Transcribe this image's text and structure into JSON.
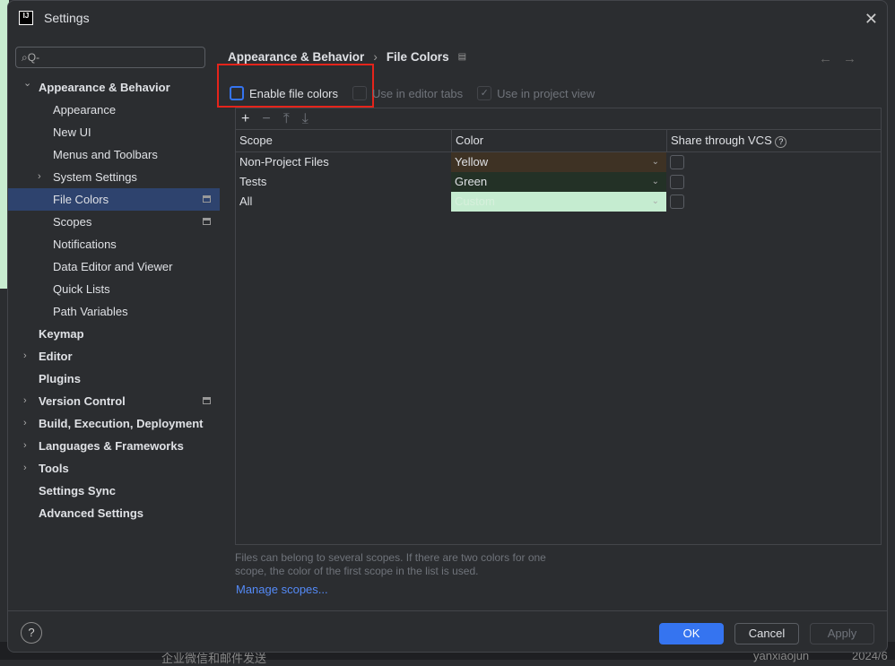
{
  "window": {
    "title": "Settings",
    "logo": "IJ"
  },
  "search": {
    "placeholder": "Q-"
  },
  "sidebar": {
    "items": [
      {
        "label": "Appearance & Behavior",
        "level": 0,
        "expanded": true
      },
      {
        "label": "Appearance",
        "level": 1
      },
      {
        "label": "New UI",
        "level": 1
      },
      {
        "label": "Menus and Toolbars",
        "level": 1
      },
      {
        "label": "System Settings",
        "level": 1,
        "collapsed": true
      },
      {
        "label": "File Colors",
        "level": 1,
        "selected": true,
        "mark": true
      },
      {
        "label": "Scopes",
        "level": 1,
        "mark": true
      },
      {
        "label": "Notifications",
        "level": 1
      },
      {
        "label": "Data Editor and Viewer",
        "level": 1
      },
      {
        "label": "Quick Lists",
        "level": 1
      },
      {
        "label": "Path Variables",
        "level": 1
      },
      {
        "label": "Keymap",
        "level": 0
      },
      {
        "label": "Editor",
        "level": 0,
        "collapsed": true
      },
      {
        "label": "Plugins",
        "level": 0
      },
      {
        "label": "Version Control",
        "level": 0,
        "collapsed": true,
        "mark": true
      },
      {
        "label": "Build, Execution, Deployment",
        "level": 0,
        "collapsed": true
      },
      {
        "label": "Languages & Frameworks",
        "level": 0,
        "collapsed": true
      },
      {
        "label": "Tools",
        "level": 0,
        "collapsed": true
      },
      {
        "label": "Settings Sync",
        "level": 0
      },
      {
        "label": "Advanced Settings",
        "level": 0
      }
    ]
  },
  "breadcrumb": {
    "parent": "Appearance & Behavior",
    "current": "File Colors"
  },
  "options": {
    "enable": "Enable file colors",
    "editor_tabs": "Use in editor tabs",
    "project_view": "Use in project view"
  },
  "table": {
    "headers": [
      "Scope",
      "Color",
      "Share through VCS"
    ],
    "rows": [
      {
        "scope": "Non-Project Files",
        "color": "Yellow",
        "bg": "#3e3224",
        "fg": "#dfe1e5"
      },
      {
        "scope": "Tests",
        "color": "Green",
        "bg": "#233126",
        "fg": "#dfe1e5"
      },
      {
        "scope": "All",
        "color": "Custom",
        "bg": "#c5ecd0",
        "fg": "#d6f0dc"
      }
    ]
  },
  "help_text": "Files can belong to several scopes. If there are two colors for one scope, the color of the first scope in the list is used.",
  "manage_scopes": "Manage scopes...",
  "buttons": {
    "ok": "OK",
    "cancel": "Cancel",
    "apply": "Apply",
    "help": "?"
  },
  "background": {
    "bottom_text": "企业微信和邮件发送",
    "user": "yanxiaojun",
    "date": "2024/6"
  }
}
